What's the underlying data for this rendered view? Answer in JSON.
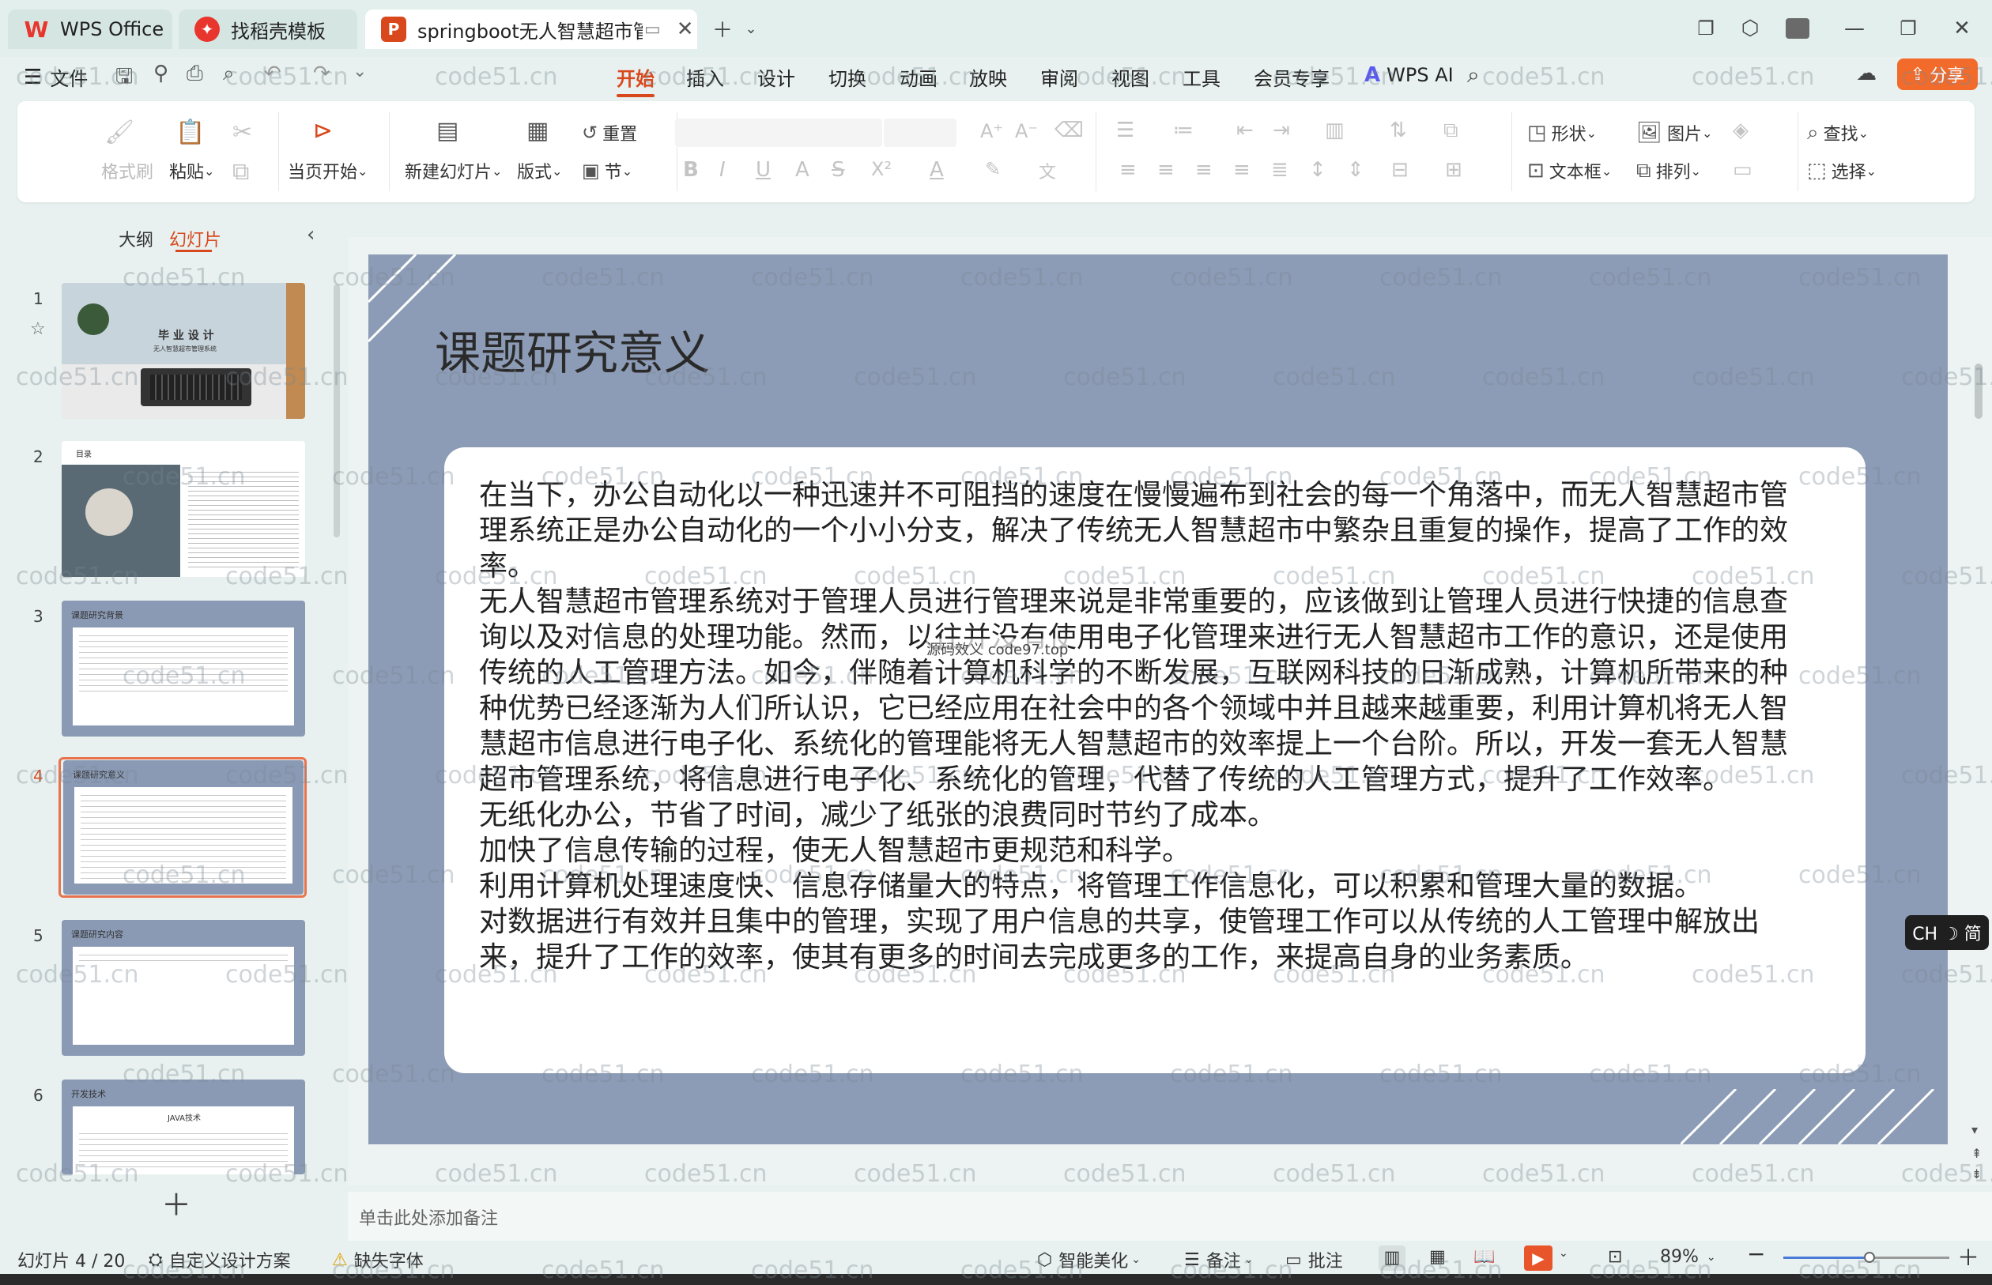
{
  "tabs": [
    {
      "label": "WPS Office",
      "color": "#e8352e"
    },
    {
      "label": "找稻壳模板",
      "color": "#e8352e"
    },
    {
      "label": "springboot无人智慧超市管理",
      "color": "#d9481c"
    }
  ],
  "menu": {
    "file": "文件",
    "items": [
      "开始",
      "插入",
      "设计",
      "切换",
      "动画",
      "放映",
      "审阅",
      "视图",
      "工具",
      "会员专享"
    ],
    "active": "开始",
    "wps_ai": "WPS AI",
    "share": "分享"
  },
  "ribbon": {
    "format_painter": "格式刷",
    "paste": "粘贴",
    "from_current": "当页开始",
    "new_slide": "新建幻灯片",
    "layout": "版式",
    "reset": "重置",
    "section": "节",
    "shape": "形状",
    "picture": "图片",
    "textbox": "文本框",
    "arrange": "排列",
    "find": "查找",
    "select": "选择"
  },
  "panel": {
    "outline_tab": "大纲",
    "slides_tab": "幻灯片",
    "thumbs": [
      {
        "num": "1",
        "title": "毕 业 设 计",
        "subtitle": "无人智慧超市管理系统"
      },
      {
        "num": "2",
        "title": "目录"
      },
      {
        "num": "3",
        "title": "课题研究背景"
      },
      {
        "num": "4",
        "title": "课题研究意义"
      },
      {
        "num": "5",
        "title": "课题研究内容"
      },
      {
        "num": "6",
        "title": "开发技术",
        "subtitle": "JAVA技术"
      }
    ]
  },
  "slide": {
    "title": "课题研究意义",
    "paragraphs": [
      "在当下，办公自动化以一种迅速并不可阻挡的速度在慢慢遍布到社会的每一个角落中，而无人智慧超市管理系统正是办公自动化的一个小小分支，解决了传统无人智慧超市中繁杂且重复的操作，提高了工作的效率。",
      "无人智慧超市管理系统对于管理人员进行管理来说是非常重要的，应该做到让管理人员进行快捷的信息查询以及对信息的处理功能。然而，以往并没有使用电子化管理来进行无人智慧超市工作的意识，还是使用传统的人工管理方法。如今，伴随着计算机科学的不断发展，互联网科技的日渐成熟，计算机所带来的种种优势已经逐渐为人们所认识，它已经应用在社会中的各个领域中并且越来越重要，利用计算机将无人智慧超市信息进行电子化、系统化的管理能将无人智慧超市的效率提上一个台阶。所以，开发一套无人智慧超市管理系统，将信息进行电子化、系统化的管理，代替了传统的人工管理方式，提升了工作效率。",
      "无纸化办公，节省了时间，减少了纸张的浪费同时节约了成本。",
      "加快了信息传输的过程，使无人智慧超市更规范和科学。",
      "利用计算机处理速度快、信息存储量大的特点，将管理工作信息化，可以积累和管理大量的数据。",
      "对数据进行有效并且集中的管理，实现了用户信息的共享，使管理工作可以从传统的人工管理中解放出来，提升了工作的效率，使其有更多的时间去完成更多的工作，来提高自身的业务素质。"
    ],
    "overlay_text": "源码效义 code97.top"
  },
  "ime": "CH ☽ 简",
  "notes_placeholder": "单击此处添加备注",
  "status": {
    "slide_count": "幻灯片 4 / 20",
    "custom_design": "自定义设计方案",
    "missing_font": "缺失字体",
    "smart_beautify": "智能美化",
    "notes": "备注",
    "comments": "批注",
    "zoom": "89%",
    "zoom_level": 0.52
  },
  "watermark": "code51.cn",
  "colors": {
    "accent": "#d9481c",
    "slide_bg": "#8d9cb6",
    "share_btn": "#f36b2b"
  }
}
